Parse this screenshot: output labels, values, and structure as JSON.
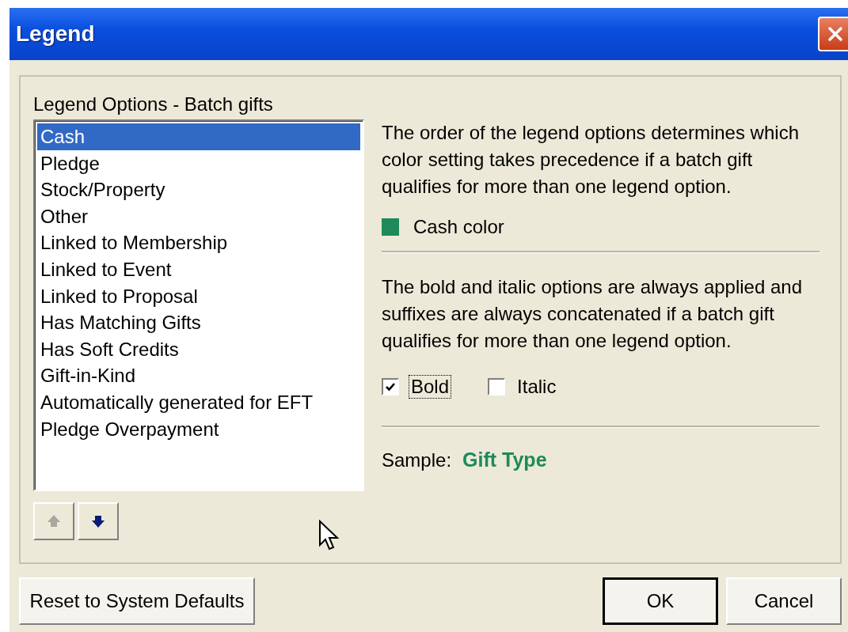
{
  "window": {
    "title": "Legend"
  },
  "group": {
    "label": "Legend Options - Batch gifts"
  },
  "list": {
    "items": [
      {
        "label": "Cash",
        "selected": true
      },
      {
        "label": "Pledge",
        "selected": false
      },
      {
        "label": "Stock/Property",
        "selected": false
      },
      {
        "label": "Other",
        "selected": false
      },
      {
        "label": "Linked to Membership",
        "selected": false
      },
      {
        "label": "Linked to Event",
        "selected": false
      },
      {
        "label": "Linked to Proposal",
        "selected": false
      },
      {
        "label": "Has Matching Gifts",
        "selected": false
      },
      {
        "label": "Has Soft Credits",
        "selected": false
      },
      {
        "label": "Gift-in-Kind",
        "selected": false
      },
      {
        "label": "Automatically generated for EFT",
        "selected": false
      },
      {
        "label": "Pledge Overpayment",
        "selected": false
      }
    ]
  },
  "move_buttons": [
    {
      "kind": "up",
      "disabled": true
    },
    {
      "kind": "down",
      "disabled": false
    }
  ],
  "order_note": "The order of the legend options determines which color setting takes precedence if a batch gift qualifies for more than one legend option.",
  "color_setting": {
    "label": "Cash color",
    "color": "#1e8a5a"
  },
  "style_note": "The bold and italic options are always applied and suffixes are always concatenated if a batch gift qualifies for more than one legend option.",
  "checkboxes": [
    {
      "label": "Bold",
      "checked": true,
      "focused": true
    },
    {
      "label": "Italic",
      "checked": false,
      "focused": false
    }
  ],
  "sample": {
    "label": "Sample:",
    "text": "Gift Type",
    "color": "#1e8a5a",
    "bold": true,
    "italic": false
  },
  "buttons": [
    {
      "label": "Reset to System Defaults",
      "default": false
    },
    {
      "label": "OK",
      "default": true
    },
    {
      "label": "Cancel",
      "default": false
    }
  ]
}
